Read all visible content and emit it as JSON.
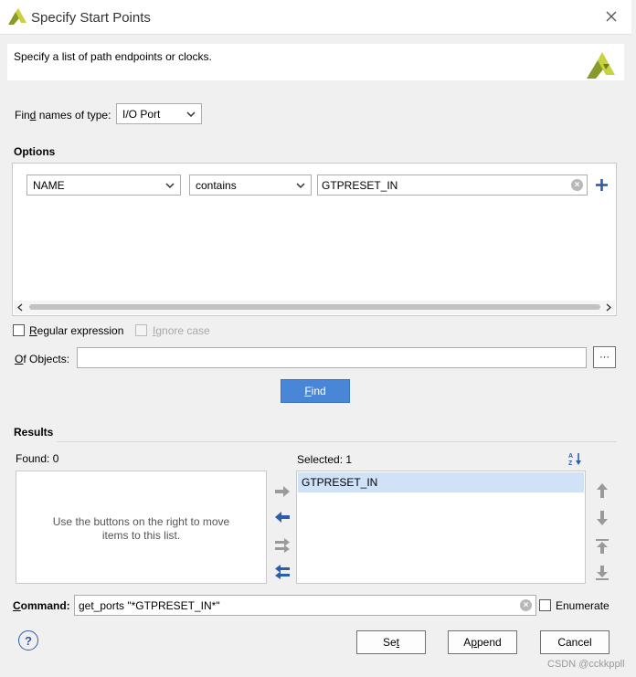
{
  "window": {
    "title": "Specify Start Points",
    "description": "Specify a list of path endpoints or clocks."
  },
  "find_names": {
    "label_pre": "Fin",
    "label_ul": "d",
    "label_post": " names of type:",
    "type_value": "I/O Port"
  },
  "options": {
    "heading": "Options",
    "field_value": "NAME",
    "operator_value": "contains",
    "pattern_value": "GTPRESET_IN"
  },
  "regex": {
    "label_ul": "R",
    "label_post": "egular expression",
    "ignore_ul": "I",
    "ignore_post": "gnore case"
  },
  "of_objects": {
    "label_ul": "O",
    "label_post": "f Objects:",
    "value": "",
    "browse_label": "···"
  },
  "find_button": {
    "label_ul": "F",
    "label_post": "ind"
  },
  "results": {
    "heading": "Results",
    "found_label": "Found: 0",
    "empty_hint_line1": "Use the buttons on the right to move",
    "empty_hint_line2": "items to this list.",
    "selected_label": "Selected: 1",
    "selected_items": [
      "GTPRESET_IN"
    ]
  },
  "command": {
    "label_ul": "C",
    "label_post": "ommand:",
    "value": "get_ports \"*GTPRESET_IN*\"",
    "enumerate_label": "Enumerate"
  },
  "buttons": {
    "set_pre": "Se",
    "set_ul": "t",
    "append_pre": "A",
    "append_ul": "p",
    "append_post": "pend",
    "cancel": "Cancel",
    "help": "?"
  },
  "watermark": "CSDN @cckkppll",
  "colors": {
    "accent": "#4a86d8",
    "logo": "#c8d23c",
    "selected_row": "#cfe2f7",
    "arrow_blue": "#2d5cab",
    "arrow_gray": "#9a9a9a"
  }
}
